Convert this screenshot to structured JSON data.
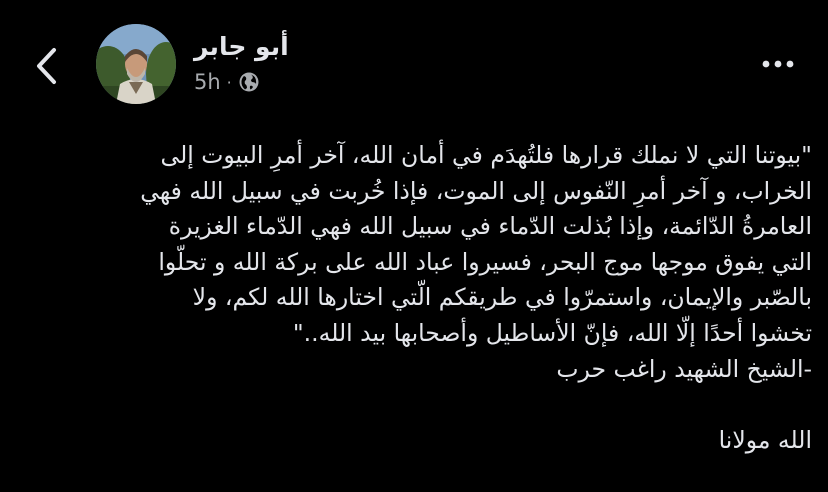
{
  "post": {
    "author_name": "أبو جابر",
    "time": "5h",
    "separator": "·",
    "privacy_icon": "globe-icon",
    "back_icon": "chevron-left-icon",
    "more_icon": "more-horizontal-icon",
    "body_lines": [
      "\"بيوتنا التي لا نملك قرارها فلتُهدَم في أمان الله، آخر أمرِ البيوت إلى",
      "الخراب، و آخر أمرِ النّفوس إلى الموت، فإذا خُربت في سبيل الله فهي",
      "العامرةُ الدّائمة، وإذا بُذلت الدّماء في سبيل الله فهي الدّماء الغزيرة",
      "التي يفوق موجها موج البحر، فسيروا عباد الله على بركة الله و تحلّوا",
      "بالصّبر والإيمان، واستمرّوا في طريقكم الّتي اختارها الله لكم، ولا",
      "تخشوا أحدًا إلّا الله، فإنّ الأساطيل وأصحابها بيد الله..\"",
      "-الشيخ الشهيد راغب حرب"
    ],
    "closing_line": "الله مولانا"
  },
  "colors": {
    "background": "#000000",
    "text": "#e4e6eb",
    "secondary_text": "#a8abaf"
  }
}
